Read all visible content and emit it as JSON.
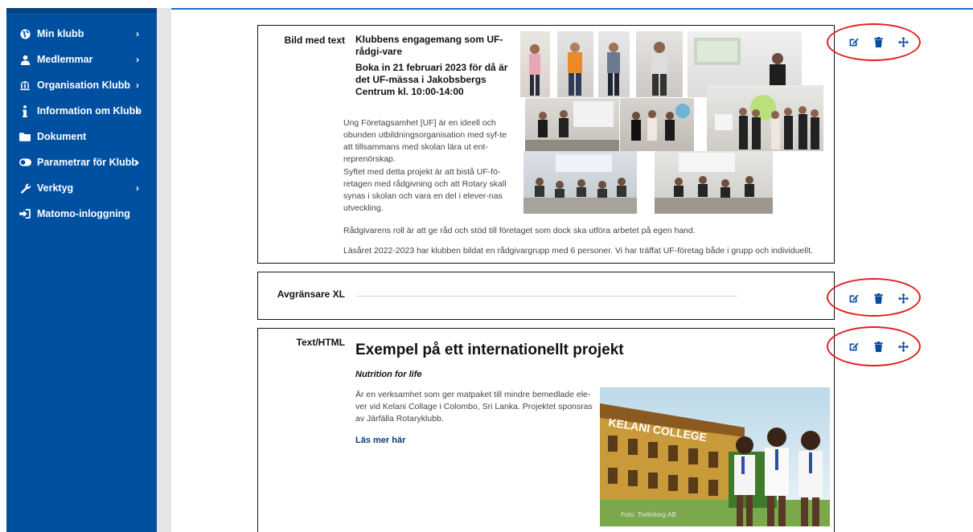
{
  "sidebar": {
    "items": [
      {
        "label": "Min klubb",
        "icon": "globe-icon",
        "has_arrow": true
      },
      {
        "label": "Medlemmar",
        "icon": "user-icon",
        "has_arrow": true
      },
      {
        "label": "Organisation Klubb",
        "icon": "institution-icon",
        "has_arrow": true
      },
      {
        "label": "Information om Klubb",
        "icon": "info-icon",
        "has_arrow": true
      },
      {
        "label": "Dokument",
        "icon": "folder-icon",
        "has_arrow": false
      },
      {
        "label": "Parametrar för Klubb",
        "icon": "toggle-icon",
        "has_arrow": true
      },
      {
        "label": "Verktyg",
        "icon": "wrench-icon",
        "has_arrow": true
      },
      {
        "label": "Matomo-inloggning",
        "icon": "sign-in-icon",
        "has_arrow": false
      }
    ],
    "arrow": "›"
  },
  "blocks": [
    {
      "type_label": "Bild med text",
      "title": "Klubbens engagemang som UF-rådgi-vare",
      "subtitle": "Boka in 21 februari 2023 för då är det UF-mässa i Jakobsbergs Centrum kl. 10:00-14:00",
      "paragraph1": "Ung Företagsamhet [UF] är en ideell och obunden utbildningsorganisation med syf-te att tillsammans med skolan lära ut ent-reprenörskap.",
      "paragraph2": "Syftet med detta projekt är att bistå UF-fö-retagen med rådgivning och att Rotary skall synas i skolan och vara en del i elever-nas utveckling.",
      "paragraph3": "Rådgivarens roll är att ge råd och stöd till företaget som dock ska utföra arbetet på egen hand.",
      "paragraph4": "Läsåret 2022-2023 har klubben bildat en rådgivargrupp med 6 personer. Vi har träffat UF-företag både i grupp och individuellt."
    },
    {
      "type_label": "Avgränsare XL"
    },
    {
      "type_label": "Text/HTML",
      "heading": "Exempel på ett internationellt projekt",
      "subheading": "Nutrition for life",
      "paragraph": "Är en verksamhet som ger matpaket till mindre bemedlade ele-ver vid Kelani Collage i Colombo, Sri Lanka. Projektet sponsras av Järfälla Rotaryklubb.",
      "link": "Läs mer här",
      "photo_sign": "KELANI COLLEGE",
      "photo_credit": "Foto: Trelleborg AB"
    }
  ],
  "actions": {
    "edit_icon": "edit-icon",
    "delete_icon": "trash-icon",
    "move_icon": "move-icon"
  },
  "colors": {
    "sidebar": "#0050a2",
    "action_icon": "#0a4aa0",
    "highlight_ring": "#e02020"
  }
}
